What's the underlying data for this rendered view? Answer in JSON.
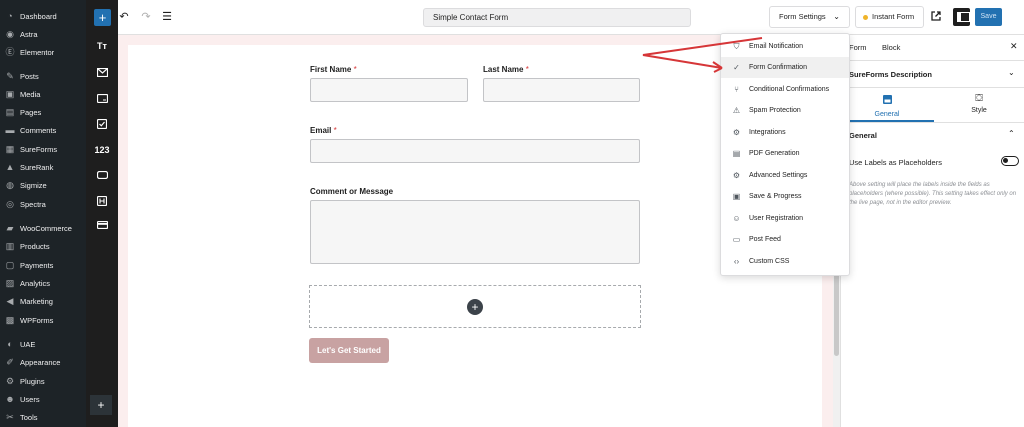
{
  "wp_menu": [
    {
      "label": "Dashboard",
      "icon": "dashboard-icon"
    },
    {
      "label": "Astra",
      "icon": "astra-icon"
    },
    {
      "label": "Elementor",
      "icon": "elementor-icon"
    },
    {
      "label": "Posts",
      "icon": "pin-icon"
    },
    {
      "label": "Media",
      "icon": "media-icon"
    },
    {
      "label": "Pages",
      "icon": "pages-icon"
    },
    {
      "label": "Comments",
      "icon": "comments-icon"
    },
    {
      "label": "SureForms",
      "icon": "sureforms-icon"
    },
    {
      "label": "SureRank",
      "icon": "surerank-icon"
    },
    {
      "label": "Sigmize",
      "icon": "sigmize-icon"
    },
    {
      "label": "Spectra",
      "icon": "spectra-icon"
    },
    {
      "label": "WooCommerce",
      "icon": "woocommerce-icon"
    },
    {
      "label": "Products",
      "icon": "products-icon"
    },
    {
      "label": "Payments",
      "icon": "payments-icon"
    },
    {
      "label": "Analytics",
      "icon": "analytics-icon"
    },
    {
      "label": "Marketing",
      "icon": "marketing-icon"
    },
    {
      "label": "WPForms",
      "icon": "wpforms-icon"
    },
    {
      "label": "UAE",
      "icon": "uae-icon"
    },
    {
      "label": "Appearance",
      "icon": "appearance-icon"
    },
    {
      "label": "Plugins",
      "icon": "plugins-icon"
    },
    {
      "label": "Users",
      "icon": "users-icon"
    },
    {
      "label": "Tools",
      "icon": "tools-icon"
    }
  ],
  "block_toolbar": {
    "items": [
      {
        "text": "Tт",
        "icon": "text-block-icon"
      },
      {
        "text": "",
        "icon": "email-block-icon"
      },
      {
        "text": "",
        "icon": "textarea-block-icon"
      },
      {
        "text": "",
        "icon": "checkbox-block-icon"
      },
      {
        "text": "123",
        "icon": "number-block-icon"
      },
      {
        "text": "",
        "icon": "url-block-icon"
      },
      {
        "text": "",
        "icon": "hidden-block-icon"
      },
      {
        "text": "",
        "icon": "payment-block-icon"
      }
    ],
    "add": "+"
  },
  "topbar": {
    "add": "+",
    "title": "Simple Contact Form",
    "form_settings": "Form Settings",
    "instant_form": "Instant Form",
    "save": "Save"
  },
  "form": {
    "first_name": "First Name",
    "last_name": "Last Name",
    "email": "Email",
    "comment": "Comment or Message",
    "required_mark": "*",
    "submit": "Let's Get Started"
  },
  "panel": {
    "tab_form": "Form",
    "tab_block": "Block",
    "description": "SureForms Description",
    "tab_general": "General",
    "tab_style": "Style",
    "section_general": "General",
    "toggle_label": "Use Labels as Placeholders",
    "help_text": "Above setting will place the labels inside the fields as placeholders (where possible). This setting takes effect only on the live page, not in the editor preview."
  },
  "dropdown": [
    {
      "label": "Email Notification",
      "icon": "shield-icon"
    },
    {
      "label": "Form Confirmation",
      "icon": "check-circle-icon"
    },
    {
      "label": "Conditional Confirmations",
      "icon": "branch-icon"
    },
    {
      "label": "Spam Protection",
      "icon": "warning-icon"
    },
    {
      "label": "Integrations",
      "icon": "integrations-icon"
    },
    {
      "label": "PDF Generation",
      "icon": "pdf-icon"
    },
    {
      "label": "Advanced Settings",
      "icon": "gear-icon"
    },
    {
      "label": "Save & Progress",
      "icon": "save-icon"
    },
    {
      "label": "User Registration",
      "icon": "user-add-icon"
    },
    {
      "label": "Post Feed",
      "icon": "post-feed-icon"
    },
    {
      "label": "Custom CSS",
      "icon": "code-icon"
    }
  ],
  "colors": {
    "accent": "#2271b1",
    "arrow": "#d63638",
    "submit": "#c8a2a2",
    "canvas_bg": "#fbeeee"
  }
}
